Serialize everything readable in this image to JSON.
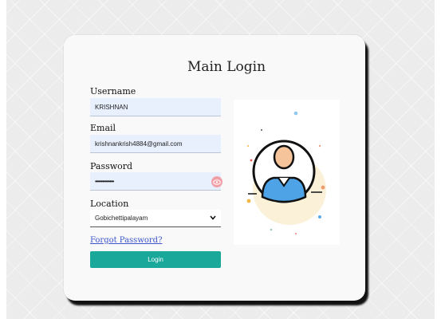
{
  "login": {
    "title": "Main Login",
    "username_label": "Username",
    "username_value": "KRISHNAN",
    "email_label": "Email",
    "email_value": "krishnankrish4884@gmail.com",
    "password_label": "Password",
    "password_value": "•••••••••••••",
    "location_label": "Location",
    "location_value": "Gobichettipalayam",
    "forgot_link": "Forgot Password?",
    "login_button": "Login"
  },
  "icons": {
    "eye": "eye-icon",
    "chevron": "chevron-down-icon",
    "user": "user-avatar-illustration"
  },
  "colors": {
    "accent": "#1aa89b",
    "input_bg": "#e8f0fe",
    "link": "#3b55c9",
    "eye_bg": "#f2a0a8"
  }
}
